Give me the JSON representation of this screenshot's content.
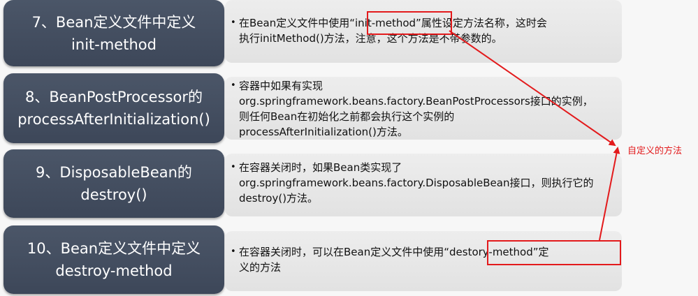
{
  "rows": [
    {
      "title_line1": "7、Bean定义文件中定义",
      "title_line2": "init-method",
      "desc_pre": "在Bean定义文件中使用",
      "desc_hl": "“init-method”",
      "desc_post": "属性设定方法名称，这时会\n执行initMethod()方法，注意，这个方法是不带参数的。"
    },
    {
      "title_line1": "8、BeanPostProcessor的",
      "title_line2": "processAfterInitialization()",
      "desc": "容器中如果有实现\norg.springframework.beans.factory.BeanPostProcessors接口的实例，\n则任何Bean在初始化之前都会执行这个实例的\nprocessAfterInitialization()方法。"
    },
    {
      "title_line1": "9、DisposableBean的",
      "title_line2": "destroy()",
      "desc": "在容器关闭时，如果Bean类实现了\norg.springframework.beans.factory.DisposableBean接口，则执行它的\ndestroy()方法。"
    },
    {
      "title_line1": "10、Bean定义文件中定义",
      "title_line2": "destroy-method",
      "desc_pre": "在容器关闭时，可以在Bean定义文件中使用",
      "desc_hl": "“destory-method”",
      "desc_post": "定\n义的方法"
    }
  ],
  "annotation": "自定义的方法",
  "colors": {
    "title_bg": "#465163",
    "desc_bg": "#e8e8e8",
    "highlight": "#e31a1c"
  }
}
